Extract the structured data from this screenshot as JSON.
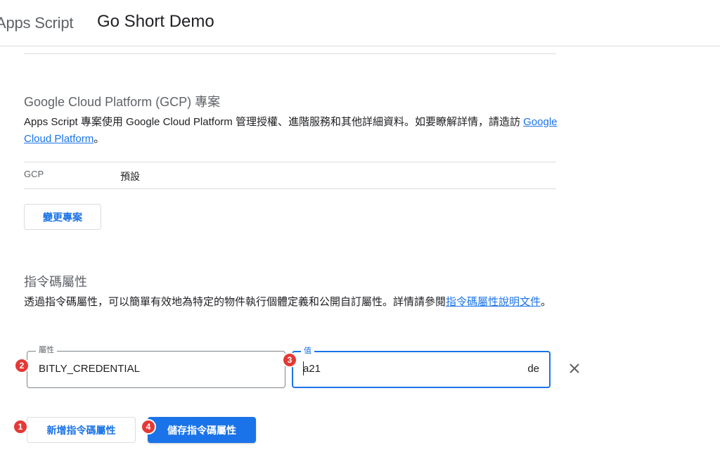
{
  "header": {
    "app_name": "Apps Script",
    "project_title": "Go Short Demo"
  },
  "gcp_section": {
    "title": "Google Cloud Platform (GCP) 專案",
    "description": "Apps Script 專案使用 Google Cloud Platform 管理授權、進階服務和其他詳細資料。如要瞭解詳情，請造訪 ",
    "link_text": "Google Cloud Platform",
    "suffix": "。",
    "row_key": "GCP",
    "row_value": "預設",
    "change_button": "變更專案"
  },
  "script_properties": {
    "title": "指令碼屬性",
    "description": "透過指令碼屬性，可以簡單有效地為特定的物件執行個體定義和公開自訂屬性。詳情請參閱",
    "link_text": "指令碼屬性說明文件",
    "suffix": "。",
    "property_label": "屬性",
    "property_value": "BITLY_CREDENTIAL",
    "value_label": "值",
    "value_start": "a21",
    "value_end": "de",
    "add_button": "新增指令碼屬性",
    "save_button": "儲存指令碼屬性"
  },
  "badges": [
    "1",
    "2",
    "3",
    "4"
  ],
  "colors": {
    "accent": "#1a73e8",
    "badge": "#e53935",
    "divider": "#dadce0"
  }
}
